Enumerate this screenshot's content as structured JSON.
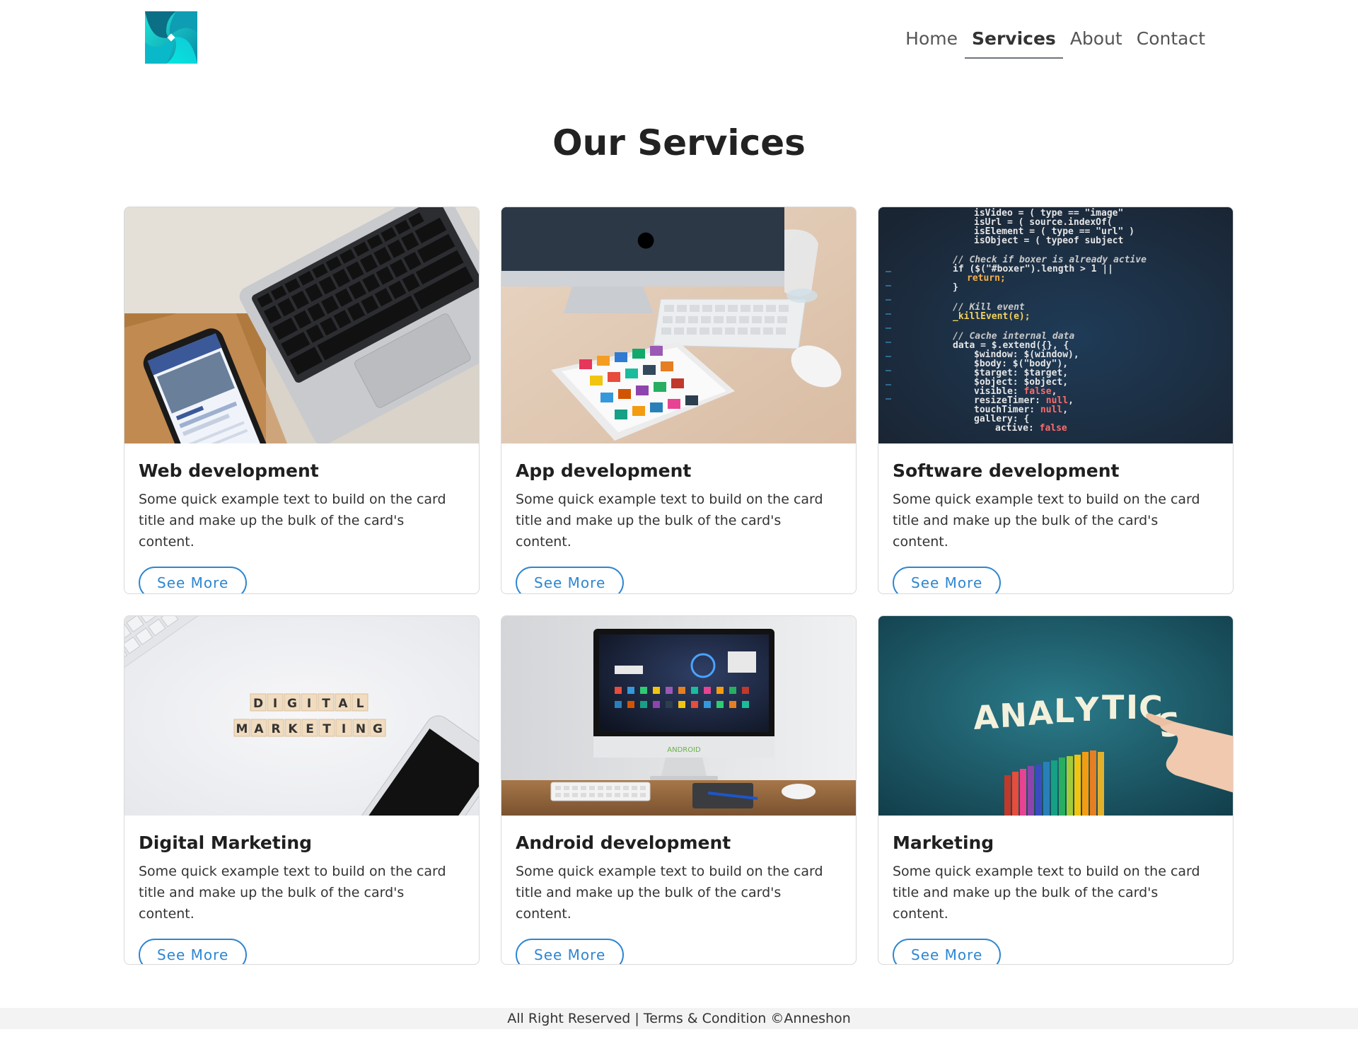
{
  "nav": {
    "items": [
      {
        "label": "Home"
      },
      {
        "label": "Services"
      },
      {
        "label": "About"
      },
      {
        "label": "Contact"
      }
    ],
    "active": "Services"
  },
  "main": {
    "title": "Our Services",
    "cards": [
      {
        "title": "Web development",
        "text": "Some quick example text to build on the card title and make up the bulk of the card's content.",
        "button": "See More",
        "image": "laptop-and-phone-photo"
      },
      {
        "title": "App development",
        "text": "Some quick example text to build on the card title and make up the bulk of the card's content.",
        "button": "See More",
        "image": "imac-and-tablet-photo"
      },
      {
        "title": "Software development",
        "text": "Some quick example text to build on the card title and make up the bulk of the card's content.",
        "button": "See More",
        "image": "code-screen-photo"
      },
      {
        "title": "Digital Marketing",
        "text": "Some quick example text to build on the card title and make up the bulk of the card's content.",
        "button": "See More",
        "image": "digital-marketing-tiles-photo"
      },
      {
        "title": "Android development",
        "text": "Some quick example text to build on the card title and make up the bulk of the card's content.",
        "button": "See More",
        "image": "android-monitor-photo"
      },
      {
        "title": "Marketing",
        "text": "Some quick example text to build on the card title and make up the bulk of the card's content.",
        "button": "See More",
        "image": "analytics-chalkboard-photo"
      }
    ]
  },
  "footer": {
    "text": "All Right Reserved | Terms & Condition ©Anneshon"
  },
  "colors": {
    "accent": "#2e86d1",
    "logo": "#15d3d3"
  },
  "photo_text": {
    "tiles_line1": "DIGITAL",
    "tiles_line2": "MARKETING",
    "analytics": "ANALYTICS"
  }
}
